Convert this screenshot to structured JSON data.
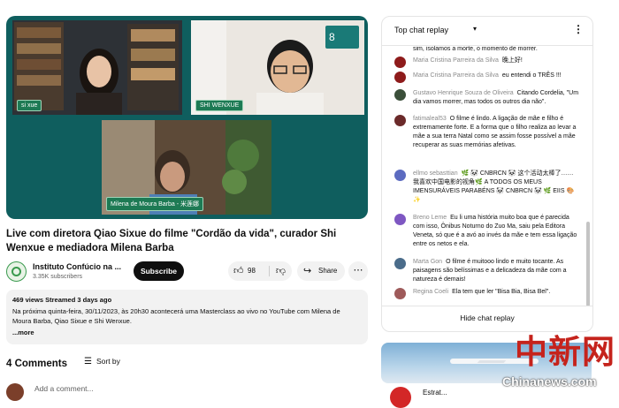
{
  "video": {
    "participants": [
      {
        "name": "si xue"
      },
      {
        "name": "SHI WENXUE"
      },
      {
        "name": "Milena de Moura Barba - 米莲娜"
      }
    ],
    "badge": "8"
  },
  "title": "Live com diretora Qiao Sixue do filme \"Cordão da vida\", curador Shi Wenxue e mediadora Milena Barba",
  "channel": {
    "name": "Instituto Confúcio na ...",
    "subscribers": "3.35K subscribers",
    "subscribe_label": "Subscribe"
  },
  "actions": {
    "like_count": "98",
    "share_label": "Share",
    "more_icon": "⋯"
  },
  "description": {
    "stats": "469 views  Streamed 3 days ago",
    "text": "Na próxima quinta-feira, 30/11/2023, às 20h30 acontecerá uma Masterclass ao vivo no YouTube com Milena de Moura Barba, Qiao Sixue e Shi Wenxue.",
    "more_label": "...more"
  },
  "comments": {
    "count_label": "4 Comments",
    "sort_label": "Sort by",
    "add_placeholder": "Add a comment..."
  },
  "chat": {
    "title": "Top chat replay",
    "partial_message": "sim, isolamos a morte, o momento de morrer.",
    "messages": [
      {
        "author": "Maria Cristina Parreira da Silva",
        "text": "晚上好!",
        "avatar_color": "#8e1b1b"
      },
      {
        "author": "Maria Cristina Parreira da Silva",
        "text": "eu entendi o TRÊS !!!",
        "avatar_color": "#8e1b1b"
      },
      {
        "author": "Gustavo Henrique Souza de Oliveira",
        "text": "Citando Cordelia, \"Um dia vamos morrer, mas todos os outros dia não\".",
        "avatar_color": "#3b4f3a"
      },
      {
        "author": "fatimaleal53",
        "text": "O filme é lindo. A ligação de mãe e filho é extremamente forte. E a forma que o filho realiza ao levar a mãe a sua terra Natal como se assim fosse possível a mãe recuperar as suas memórias afetivas.",
        "avatar_color": "#6b2a2a"
      },
      {
        "author": "ellmo sebasttian",
        "text": "🌿 🐼 CNBRCN 🐼 这个活动太棒了……我喜欢中国电影的视角🌿 A TODOS OS MEUS IMENSURÁVEIS PARABÉNS 🐼 CNBRCN 🐼 🌿 EIIS 🎨 ✨",
        "avatar_color": "#5c6bc0"
      },
      {
        "author": "Breno Leme",
        "text": "Eu li uma história muito boa que é parecida com isso, Ônibus Noturno do Zuo Ma, saiu pela Editora Veneta, só que é a avó ao invés da mãe e tem essa ligação entre os netos e ela.",
        "avatar_color": "#7e57c2"
      },
      {
        "author": "Marta Gon",
        "text": "O filme é muitooo lindo e muito tocante. As paisagens são belíssimas e a delicadeza da mãe com a natureza é demais!",
        "avatar_color": "#4a6c8a"
      },
      {
        "author": "Regina Coeli",
        "text": "Ela tem que ler \"Bisa Bia, Bisa Bel\".",
        "avatar_color": "#9e5a5a"
      }
    ],
    "hide_label": "Hide chat replay",
    "menu_icon": "⋮"
  },
  "ad": {
    "text": "Estrat..."
  },
  "watermark": {
    "chinese": "中新网",
    "english": "Chinanews.com"
  }
}
